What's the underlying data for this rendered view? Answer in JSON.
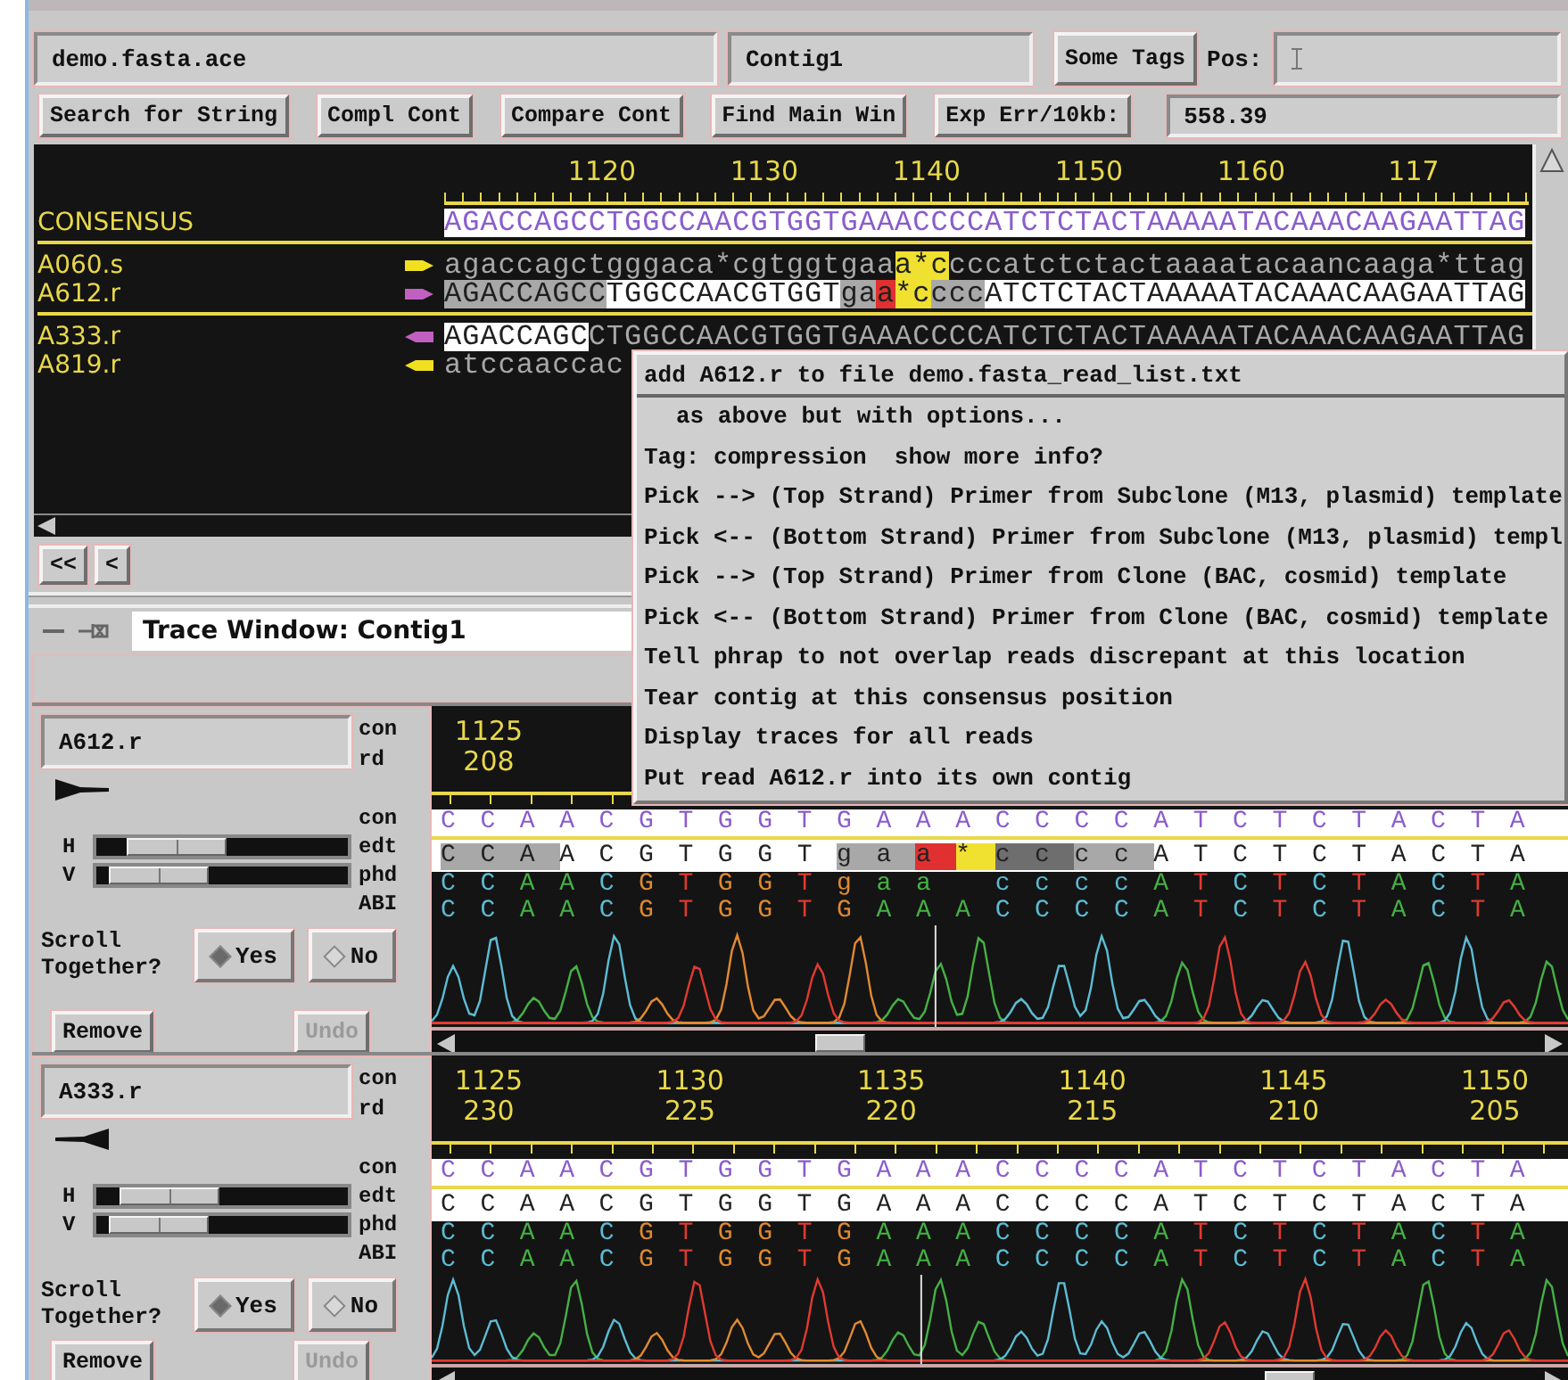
{
  "files_bar": {
    "file": "demo.fasta.ace",
    "contig": "Contig1",
    "tags_button": "Some Tags",
    "pos_label": "Pos:"
  },
  "toolbar": {
    "buttons": [
      "Search for String",
      "Compl Cont",
      "Compare Cont",
      "Find Main Win",
      "Exp Err/10kb:"
    ],
    "error_value": "558.39"
  },
  "alignment": {
    "ruler": [
      "1120",
      "1130",
      "1140",
      "1150",
      "1160",
      "117"
    ],
    "rows": [
      {
        "name": "CONSENSUS",
        "kind": "consensus",
        "segments": [
          {
            "text": "AGACCAGCCTGGCCAACGTGGTGAAACCCCATCTCTACTAAAAATACAAACAAGAATTAG",
            "color": "#ffffff"
          }
        ]
      },
      {
        "name": "A060.s",
        "kind": "read",
        "reverse": false,
        "color": "#f0e020",
        "segments": [
          {
            "text": "agaccagctgggaca*cgtggtgaa"
          },
          {
            "text": "a*c",
            "color": "#f0e030"
          },
          {
            "text": "cccatctctactaaaatacaancaaga*ttag"
          }
        ]
      },
      {
        "name": "A612.r",
        "kind": "read",
        "reverse": false,
        "color": "#c060c0",
        "segments": [
          {
            "text": "AGACCAGCC",
            "color": "#a8a8a8"
          },
          {
            "text": "TGGCCAACGTGGT",
            "color": "#ffffff"
          },
          {
            "text": "ga",
            "color": "#a8a8a8"
          },
          {
            "text": "a",
            "color": "#e03030"
          },
          {
            "text": "*c",
            "color": "#f0e030"
          },
          {
            "text": "ccc",
            "color": "#a8a8a8"
          },
          {
            "text": "ATCTCTACTAAAAATACAAACAAGAATTAG",
            "color": "#ffffff"
          }
        ]
      },
      {
        "name": "A333.r",
        "kind": "read",
        "reverse": true,
        "color": "#c060c0",
        "segments": [
          {
            "text": "AGACCAGC",
            "color": "#ffffff"
          },
          {
            "text": "CTGGCCAACGTGGTGAAACCCCATCTCTACTAAAAATACAAACAAGAATTAG"
          }
        ]
      },
      {
        "name": "A819.r",
        "kind": "read",
        "reverse": true,
        "color": "#f0e020",
        "segments": [
          {
            "text": "atccaaccac"
          }
        ]
      }
    ]
  },
  "nav_buttons": [
    "<<",
    "<"
  ],
  "menu": {
    "items": [
      {
        "label": "add A612.r to file demo.fasta_read_list.txt",
        "indent": false,
        "separator": true
      },
      {
        "label": "as above but with options...",
        "indent": true,
        "separator": false
      },
      {
        "label": "Tag: compression  show more info?",
        "indent": false,
        "separator": false
      },
      {
        "label": "Pick --> (Top Strand) Primer from Subclone (M13, plasmid) template",
        "indent": false,
        "separator": false
      },
      {
        "label": "Pick <-- (Bottom Strand) Primer from Subclone (M13, plasmid) templ",
        "indent": false,
        "separator": false
      },
      {
        "label": "Pick --> (Top Strand) Primer from Clone (BAC, cosmid) template",
        "indent": false,
        "separator": false
      },
      {
        "label": "Pick <-- (Bottom Strand) Primer from Clone (BAC, cosmid) template",
        "indent": false,
        "separator": false
      },
      {
        "label": "Tell phrap to not overlap reads discrepant at this location",
        "indent": false,
        "separator": false
      },
      {
        "label": "Tear contig at this consensus position",
        "indent": false,
        "separator": false
      },
      {
        "label": "Display traces for all reads",
        "indent": false,
        "separator": false
      },
      {
        "label": "Put read A612.r into its own contig",
        "indent": false,
        "separator": false
      }
    ]
  },
  "trace_window": {
    "title": "Trace Window: Contig1",
    "panels": [
      {
        "read": "A612.r",
        "reverse": false,
        "row_labels": [
          "con",
          "rd",
          "con",
          "edt",
          "phd",
          "ABI"
        ],
        "sliders": [
          {
            "label": "H",
            "level": 0.2
          },
          {
            "label": "V",
            "level": 0.08
          }
        ],
        "scroll_label": "Scroll Together?",
        "options": [
          {
            "label": "Yes",
            "selected": true
          },
          {
            "label": "No",
            "selected": false
          }
        ],
        "buttons": [
          {
            "label": "Remove",
            "disabled": false
          },
          {
            "label": "Undo",
            "disabled": true
          }
        ],
        "ruler": [
          {
            "con": "1125",
            "rd": "208"
          }
        ],
        "bases": [
          {
            "kind": "consensus",
            "segments": [
              {
                "text": "CCAACGTGGTGAAACCCCATCTCTACTA"
              }
            ]
          },
          {
            "kind": "edited",
            "segments": [
              {
                "text": "CCA",
                "color": "#a8a8a8"
              },
              {
                "text": "ACGTGGT",
                "color": "#ffffff"
              },
              {
                "text": "ga",
                "color": "#a8a8a8"
              },
              {
                "text": "a",
                "color": "#e03030"
              },
              {
                "text": "*",
                "color": "#f0e030"
              },
              {
                "text": "cc",
                "color": "#6e6e6e"
              },
              {
                "text": "cc",
                "color": "#a8a8a8"
              },
              {
                "text": "ATCTCTACTA",
                "color": "#ffffff"
              }
            ]
          },
          {
            "kind": "called",
            "segments": [
              {
                "text": "CCAACGTGGTgaa ccccATCTCTACTA"
              }
            ]
          },
          {
            "kind": "called",
            "segments": [
              {
                "text": "CCAACGTGGTGAAACCCCATCTCTACTA"
              }
            ]
          }
        ]
      },
      {
        "read": "A333.r",
        "reverse": true,
        "row_labels": [
          "con",
          "rd",
          "con",
          "edt",
          "phd",
          "ABI"
        ],
        "sliders": [
          {
            "label": "H",
            "level": 0.15
          },
          {
            "label": "V",
            "level": 0.08
          }
        ],
        "scroll_label": "Scroll Together?",
        "options": [
          {
            "label": "Yes",
            "selected": true
          },
          {
            "label": "No",
            "selected": false
          }
        ],
        "buttons": [
          {
            "label": "Remove",
            "disabled": false
          },
          {
            "label": "Undo",
            "disabled": true
          }
        ],
        "ruler": [
          {
            "con": "1125",
            "rd": "230"
          },
          {
            "con": "1130",
            "rd": "225"
          },
          {
            "con": "1135",
            "rd": "220"
          },
          {
            "con": "1140",
            "rd": "215"
          },
          {
            "con": "1145",
            "rd": "210"
          },
          {
            "con": "1150",
            "rd": "205"
          }
        ],
        "bases": [
          {
            "kind": "consensus",
            "segments": [
              {
                "text": "CCAACGTGGTGAAACCCCATCTCTACTA"
              }
            ]
          },
          {
            "kind": "edited",
            "segments": [
              {
                "text": "CCAACGTGGTGAAACCCCATCTCTACTA",
                "color": "#ffffff"
              }
            ]
          },
          {
            "kind": "called",
            "segments": [
              {
                "text": "CCAACGTGGTGAAACCCCATCTCTACTA"
              }
            ]
          },
          {
            "kind": "called",
            "segments": [
              {
                "text": "CCAACGTGGTGAAACCCCATCTCTACTA"
              }
            ]
          }
        ]
      }
    ]
  }
}
